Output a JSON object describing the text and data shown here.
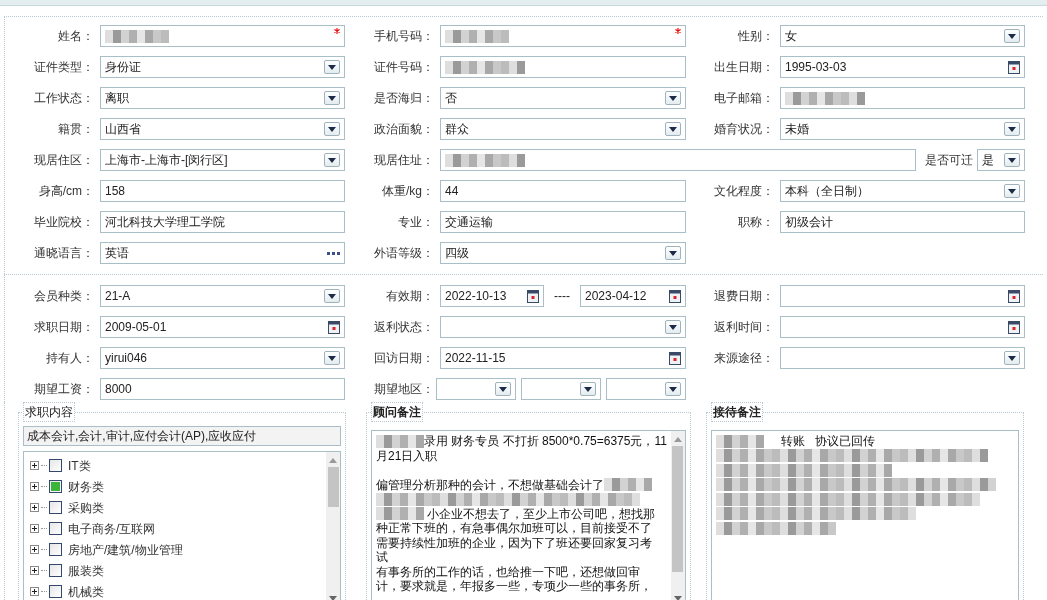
{
  "section_personal": {
    "rows": [
      [
        {
          "label": "姓名：",
          "kind": "redacted",
          "required": true
        },
        {
          "label": "手机号码：",
          "kind": "redacted",
          "required": true
        },
        {
          "label": "性别：",
          "kind": "select",
          "value": "女",
          "required": false
        }
      ],
      [
        {
          "label": "证件类型：",
          "kind": "select",
          "value": "身份证",
          "required": false
        },
        {
          "label": "证件号码：",
          "kind": "redacted",
          "required": false
        },
        {
          "label": "出生日期：",
          "kind": "date",
          "value": "1995-03-03",
          "required": false
        }
      ],
      [
        {
          "label": "工作状态：",
          "kind": "select",
          "value": "离职",
          "required": false
        },
        {
          "label": "是否海归：",
          "kind": "select",
          "value": "否",
          "required": false
        },
        {
          "label": "电子邮箱：",
          "kind": "redacted",
          "required": false
        }
      ],
      [
        {
          "label": "籍贯：",
          "kind": "select",
          "value": "山西省",
          "required": false
        },
        {
          "label": "政治面貌：",
          "kind": "select",
          "value": "群众",
          "required": false
        },
        {
          "label": "婚育状况：",
          "kind": "select",
          "value": "未婚",
          "required": false
        }
      ],
      [
        {
          "label": "现居住区：",
          "kind": "select",
          "value": "上海市-上海市-[闵行区]",
          "required": false
        },
        {
          "label": "现居住址：",
          "kind": "redacted",
          "required": false,
          "extra": {
            "label": "是否可迁",
            "value": "是"
          }
        }
      ],
      [
        {
          "label": "身高/cm：",
          "kind": "text",
          "value": "158",
          "required": false
        },
        {
          "label": "体重/kg：",
          "kind": "text",
          "value": "44",
          "required": false
        },
        {
          "label": "文化程度：",
          "kind": "select",
          "value": "本科（全日制）",
          "required": false
        }
      ],
      [
        {
          "label": "毕业院校：",
          "kind": "text",
          "value": "河北科技大学理工学院",
          "required": false
        },
        {
          "label": "专业：",
          "kind": "text",
          "value": "交通运输",
          "required": false
        },
        {
          "label": "职称：",
          "kind": "text",
          "value": "初级会计",
          "required": false
        }
      ],
      [
        {
          "label": "通晓语言：",
          "kind": "more",
          "value": "英语",
          "required": false
        },
        {
          "label": "外语等级：",
          "kind": "select",
          "value": "四级",
          "required": false
        }
      ]
    ]
  },
  "section_membership": {
    "rows": [
      [
        {
          "label": "会员种类：",
          "kind": "select",
          "value": "21-A"
        },
        {
          "label": "有效期：",
          "kind": "date_range",
          "values": [
            "2022-10-13",
            "2023-04-12"
          ],
          "separator": "----"
        },
        {
          "label": "退费日期：",
          "kind": "date"
        }
      ],
      [
        {
          "label": "求职日期：",
          "kind": "date",
          "value": "2009-05-01"
        },
        {
          "label": "返利状态：",
          "kind": "select"
        },
        {
          "label": "返利时间：",
          "kind": "date"
        }
      ],
      [
        {
          "label": "持有人：",
          "kind": "select",
          "value": "yirui046"
        },
        {
          "label": "回访日期：",
          "kind": "date",
          "value": "2022-11-15"
        },
        {
          "label": "来源途径：",
          "kind": "select"
        }
      ],
      [
        {
          "label": "期望工资：",
          "kind": "text",
          "value": "8000"
        },
        {
          "label": "期望地区：",
          "kind": "multi_select",
          "parts": [
            {
              "kind": "select"
            },
            {
              "kind": "select"
            },
            {
              "kind": "select"
            }
          ]
        }
      ]
    ]
  },
  "job_content": {
    "title": "求职内容",
    "summary": "成本会计,会计,审计,应付会计(AP),应收应付",
    "tree": [
      {
        "label": "IT类",
        "checked": false,
        "expanded": false
      },
      {
        "label": "财务类",
        "checked": true,
        "expanded": false
      },
      {
        "label": "采购类",
        "checked": false,
        "expanded": false
      },
      {
        "label": "电子商务/互联网",
        "checked": false,
        "expanded": false
      },
      {
        "label": "房地产/建筑/物业管理",
        "checked": false,
        "expanded": false
      },
      {
        "label": "服装类",
        "checked": false,
        "expanded": false
      },
      {
        "label": "机械类",
        "checked": false,
        "expanded": false
      }
    ]
  },
  "adviser_notes": {
    "title": "顾问备注",
    "lines": [
      [
        {
          "kind": "redacted"
        },
        {
          "kind": "text",
          "text": "录用 财务专员 不打折 8500*0.75=6375元，11"
        }
      ],
      [
        {
          "kind": "text",
          "text": "月21日入职"
        }
      ],
      [
        {
          "kind": "blank"
        }
      ],
      [
        {
          "kind": "text",
          "text": "偏管理分析那种的会计，不想做基础会计了"
        },
        {
          "kind": "redacted"
        }
      ],
      [
        {
          "kind": "redacted_line"
        }
      ],
      [
        {
          "kind": "redacted"
        },
        {
          "kind": "text",
          "text": " 小企业不想去了，至少上市公司吧，想找那"
        }
      ],
      [
        {
          "kind": "text",
          "text": "种正常下班的，有急事偶尔加班可以，目前接受不了"
        }
      ],
      [
        {
          "kind": "text",
          "text": "需要持续性加班的企业，因为下了班还要回家复习考"
        }
      ],
      [
        {
          "kind": "text",
          "text": "试"
        }
      ],
      [
        {
          "kind": "text",
          "text": "有事务所的工作的话，也给推一下吧，还想做回审"
        }
      ],
      [
        {
          "kind": "text",
          "text": "计，要求就是，年报多一些，专项少一些的事务所，"
        }
      ]
    ]
  },
  "reception_notes": {
    "title": "接待备注",
    "lines": [
      [
        {
          "kind": "redacted"
        },
        {
          "kind": "text",
          "text": "     转账   协议已回传"
        }
      ],
      [
        {
          "kind": "redacted_line"
        }
      ],
      [
        {
          "kind": "redacted_line"
        }
      ],
      [
        {
          "kind": "redacted_line"
        }
      ],
      [
        {
          "kind": "redacted_line"
        }
      ],
      [
        {
          "kind": "redacted_line"
        }
      ],
      [
        {
          "kind": "redacted_line"
        }
      ]
    ]
  }
}
